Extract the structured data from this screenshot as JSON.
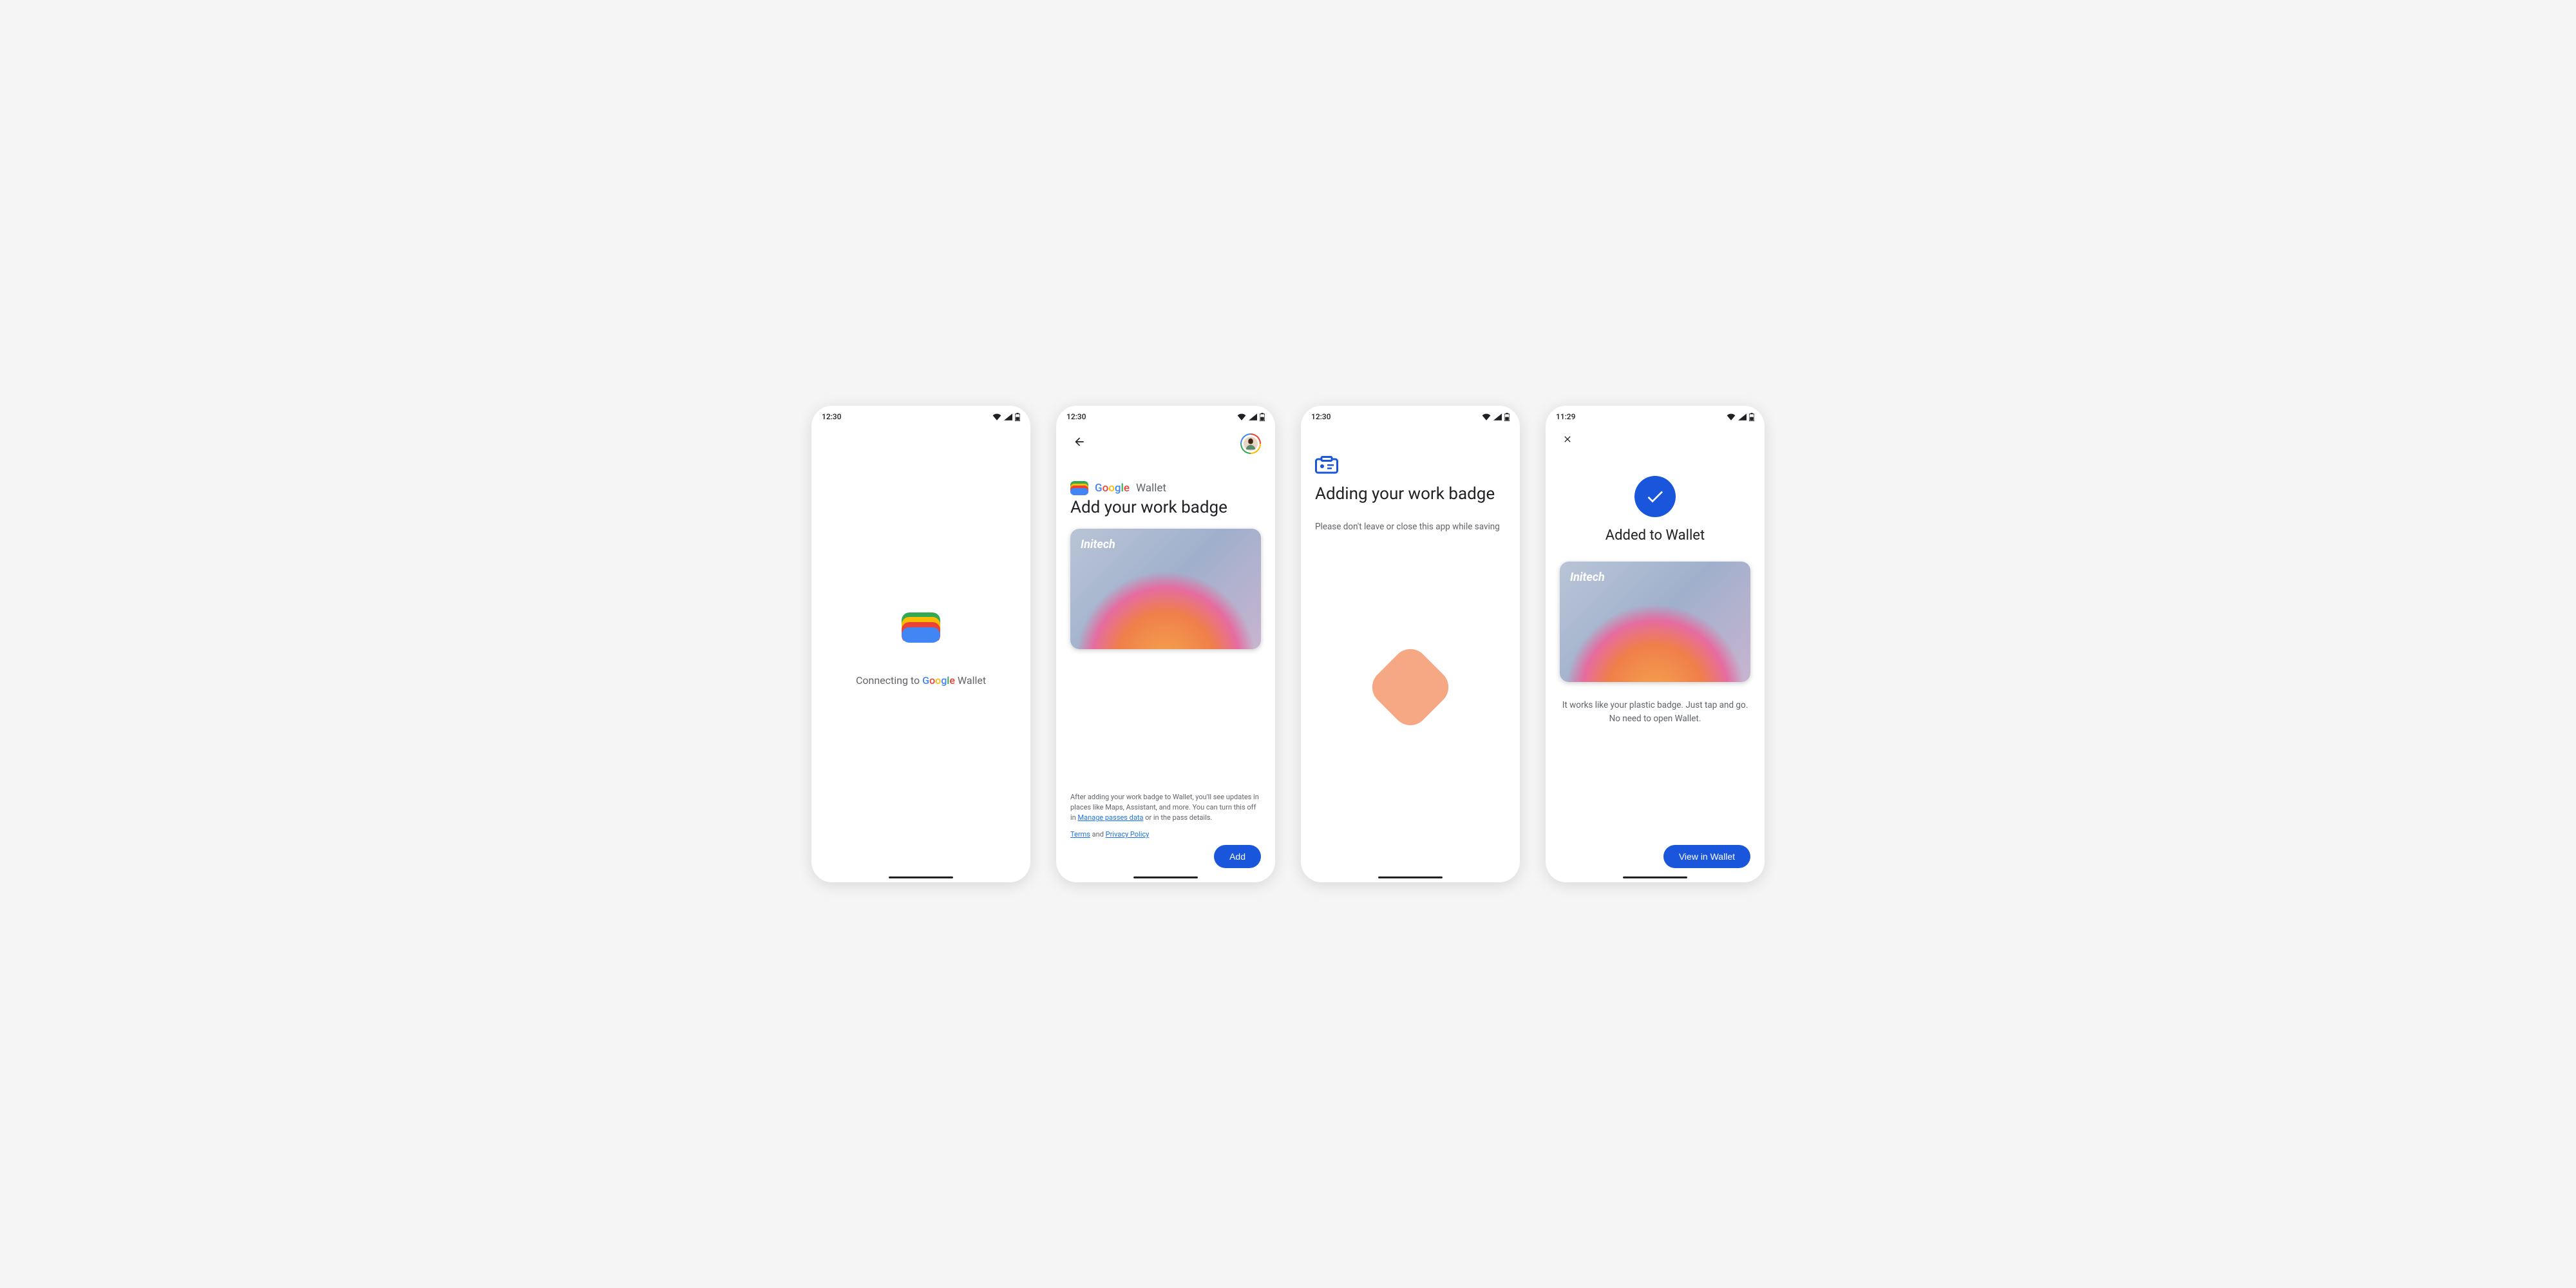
{
  "screens": [
    {
      "time": "12:30",
      "connecting": "Connecting to",
      "brand_g": "Google",
      "brand_w": "Wallet"
    },
    {
      "time": "12:30",
      "brand_g": "Google",
      "brand_w": "Wallet",
      "title": "Add your work badge",
      "card_brand": "Initech",
      "disclosure_pre": "After adding your work badge to Wallet, you'll see updates in places like Maps, Assistant, and more. You can turn this off in ",
      "manage_link": "Manage passes data",
      "disclosure_post": " or in the pass details.",
      "terms": "Terms",
      "and": " and ",
      "privacy": "Privacy Policy",
      "btn": "Add"
    },
    {
      "time": "12:30",
      "title": "Adding your work badge",
      "subtitle": "Please don't leave or close this app while saving"
    },
    {
      "time": "11:29",
      "title": "Added to Wallet",
      "card_brand": "Initech",
      "desc": "It works like your plastic badge. Just tap and go. No need to open Wallet.",
      "btn": "View in Wallet"
    }
  ]
}
